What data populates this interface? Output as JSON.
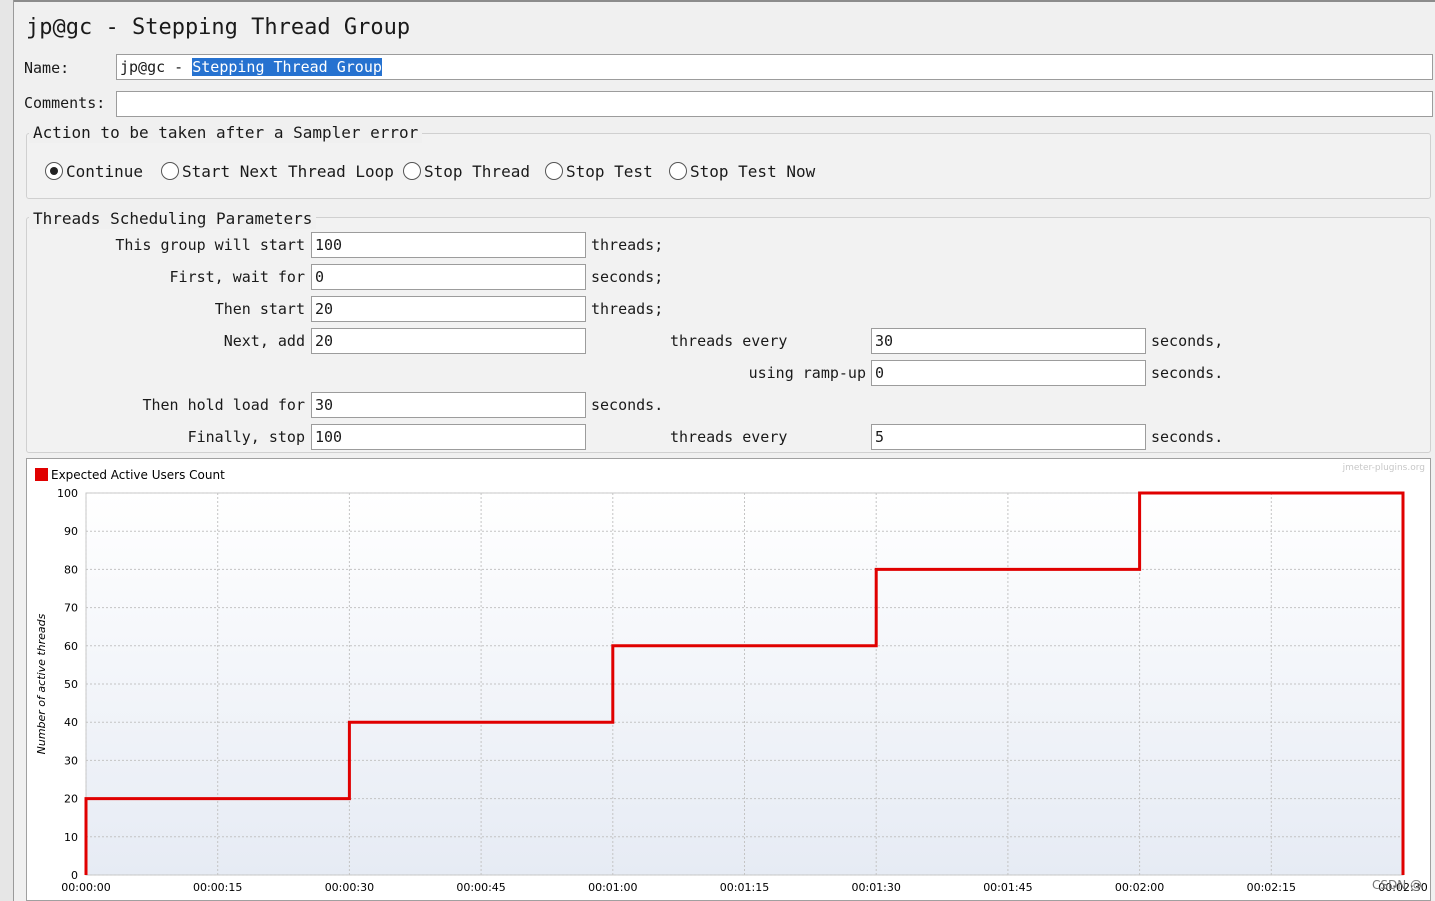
{
  "window": {
    "title": "jp@gc - Stepping Thread Group"
  },
  "form": {
    "name_label": "Name:",
    "name_value_prefix": "jp@gc - ",
    "name_value_selected": "Stepping Thread Group",
    "comments_label": "Comments:",
    "comments_value": ""
  },
  "sampler_error": {
    "legend": "Action to be taken after a Sampler error",
    "options": [
      "Continue",
      "Start Next Thread Loop",
      "Stop Thread",
      "Stop Test",
      "Stop Test Now"
    ],
    "selected": "Continue"
  },
  "scheduling": {
    "legend": "Threads Scheduling Parameters",
    "start_label": "This group will start",
    "start_value": "100",
    "start_unit": "threads;",
    "wait_label": "First, wait for",
    "wait_value": "0",
    "wait_unit": "seconds;",
    "then_start_label": "Then start",
    "then_start_value": "20",
    "then_start_unit": "threads;",
    "next_add_label": "Next, add",
    "next_add_value": "20",
    "next_add_every_label": "threads every",
    "next_add_every_value": "30",
    "next_add_every_unit": "seconds,",
    "rampup_label": "using ramp-up",
    "rampup_value": "0",
    "rampup_unit": "seconds.",
    "hold_label": "Then hold load for",
    "hold_value": "30",
    "hold_unit": "seconds.",
    "stop_label": "Finally, stop",
    "stop_value": "100",
    "stop_every_label": "threads every",
    "stop_every_value": "5",
    "stop_every_unit": "seconds."
  },
  "chart_data": {
    "type": "line",
    "legend": "Expected Active Users Count",
    "ylabel": "Number of active threads",
    "xlabel": "",
    "brand": "jmeter-plugins.org",
    "series_color": "#e00000",
    "ylim": [
      0,
      100
    ],
    "xlim_seconds": [
      0,
      150
    ],
    "x_ticks": [
      "00:00:00",
      "00:00:15",
      "00:00:30",
      "00:00:45",
      "00:01:00",
      "00:01:15",
      "00:01:30",
      "00:01:45",
      "00:02:00",
      "00:02:15",
      "00:02:30"
    ],
    "y_ticks": [
      0,
      10,
      20,
      30,
      40,
      50,
      60,
      70,
      80,
      90,
      100
    ],
    "grid": true,
    "series": [
      {
        "name": "Expected Active Users Count",
        "points": [
          [
            "00:00:00",
            0
          ],
          [
            "00:00:00",
            20
          ],
          [
            "00:00:30",
            20
          ],
          [
            "00:00:30",
            40
          ],
          [
            "00:01:00",
            40
          ],
          [
            "00:01:00",
            60
          ],
          [
            "00:01:30",
            60
          ],
          [
            "00:01:30",
            80
          ],
          [
            "00:02:00",
            80
          ],
          [
            "00:02:00",
            100
          ],
          [
            "00:02:30",
            100
          ],
          [
            "00:02:30",
            0
          ]
        ]
      }
    ]
  },
  "watermark": "CSDN @"
}
